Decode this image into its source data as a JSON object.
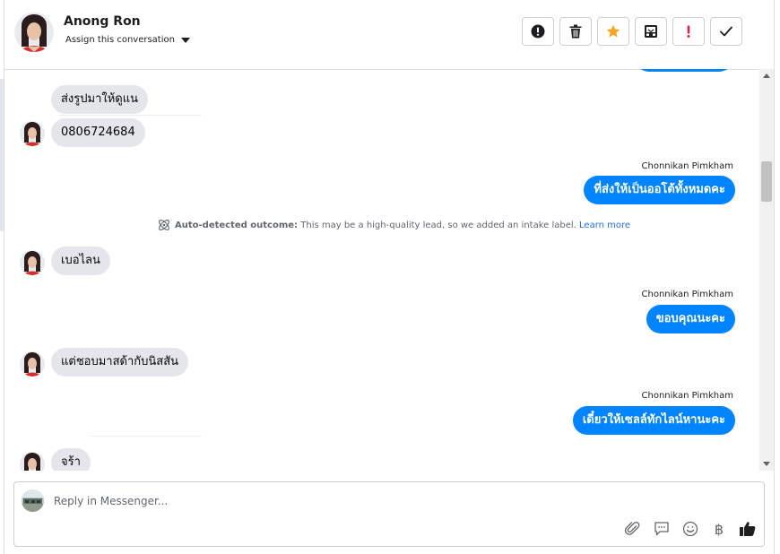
{
  "header": {
    "contact_name": "Anong Ron",
    "assign_label": "Assign this conversation"
  },
  "toolbar": {
    "icons": [
      "alert-circle-icon",
      "trash-icon",
      "star-icon",
      "inbox-icon",
      "exclamation-icon",
      "check-icon"
    ],
    "star_color": "#f5a623",
    "exclamation_color": "#e41e3f"
  },
  "messages": {
    "m1": "ส่งรูปมาให้ดูแน",
    "m2": "0806724684",
    "sender1": "Chonnikan Pimkham",
    "o1": "ที่ส่งให้เป็นออโต้ทั้งหมดคะ",
    "notice_bold": "Auto-detected outcome:",
    "notice_text": "This may be a high-quality lead, so we added an intake label.",
    "notice_link": "Learn more",
    "m3": "เบอไลน",
    "sender2": "Chonnikan Pimkham",
    "o2": "ขอบคุณนะคะ",
    "m4": "แต่ชอบมาสด้ากับนิสสัน",
    "sender3": "Chonnikan Pimkham",
    "o3": "เดี๋ยวให้เซลล์ทักไลน์หานะคะ",
    "m5": "จร้า"
  },
  "composer": {
    "placeholder": "Reply in Messenger...",
    "baht_symbol": "฿"
  },
  "colors": {
    "brand_blue": "#0084ff",
    "incoming_bubble": "#e4e6eb"
  }
}
